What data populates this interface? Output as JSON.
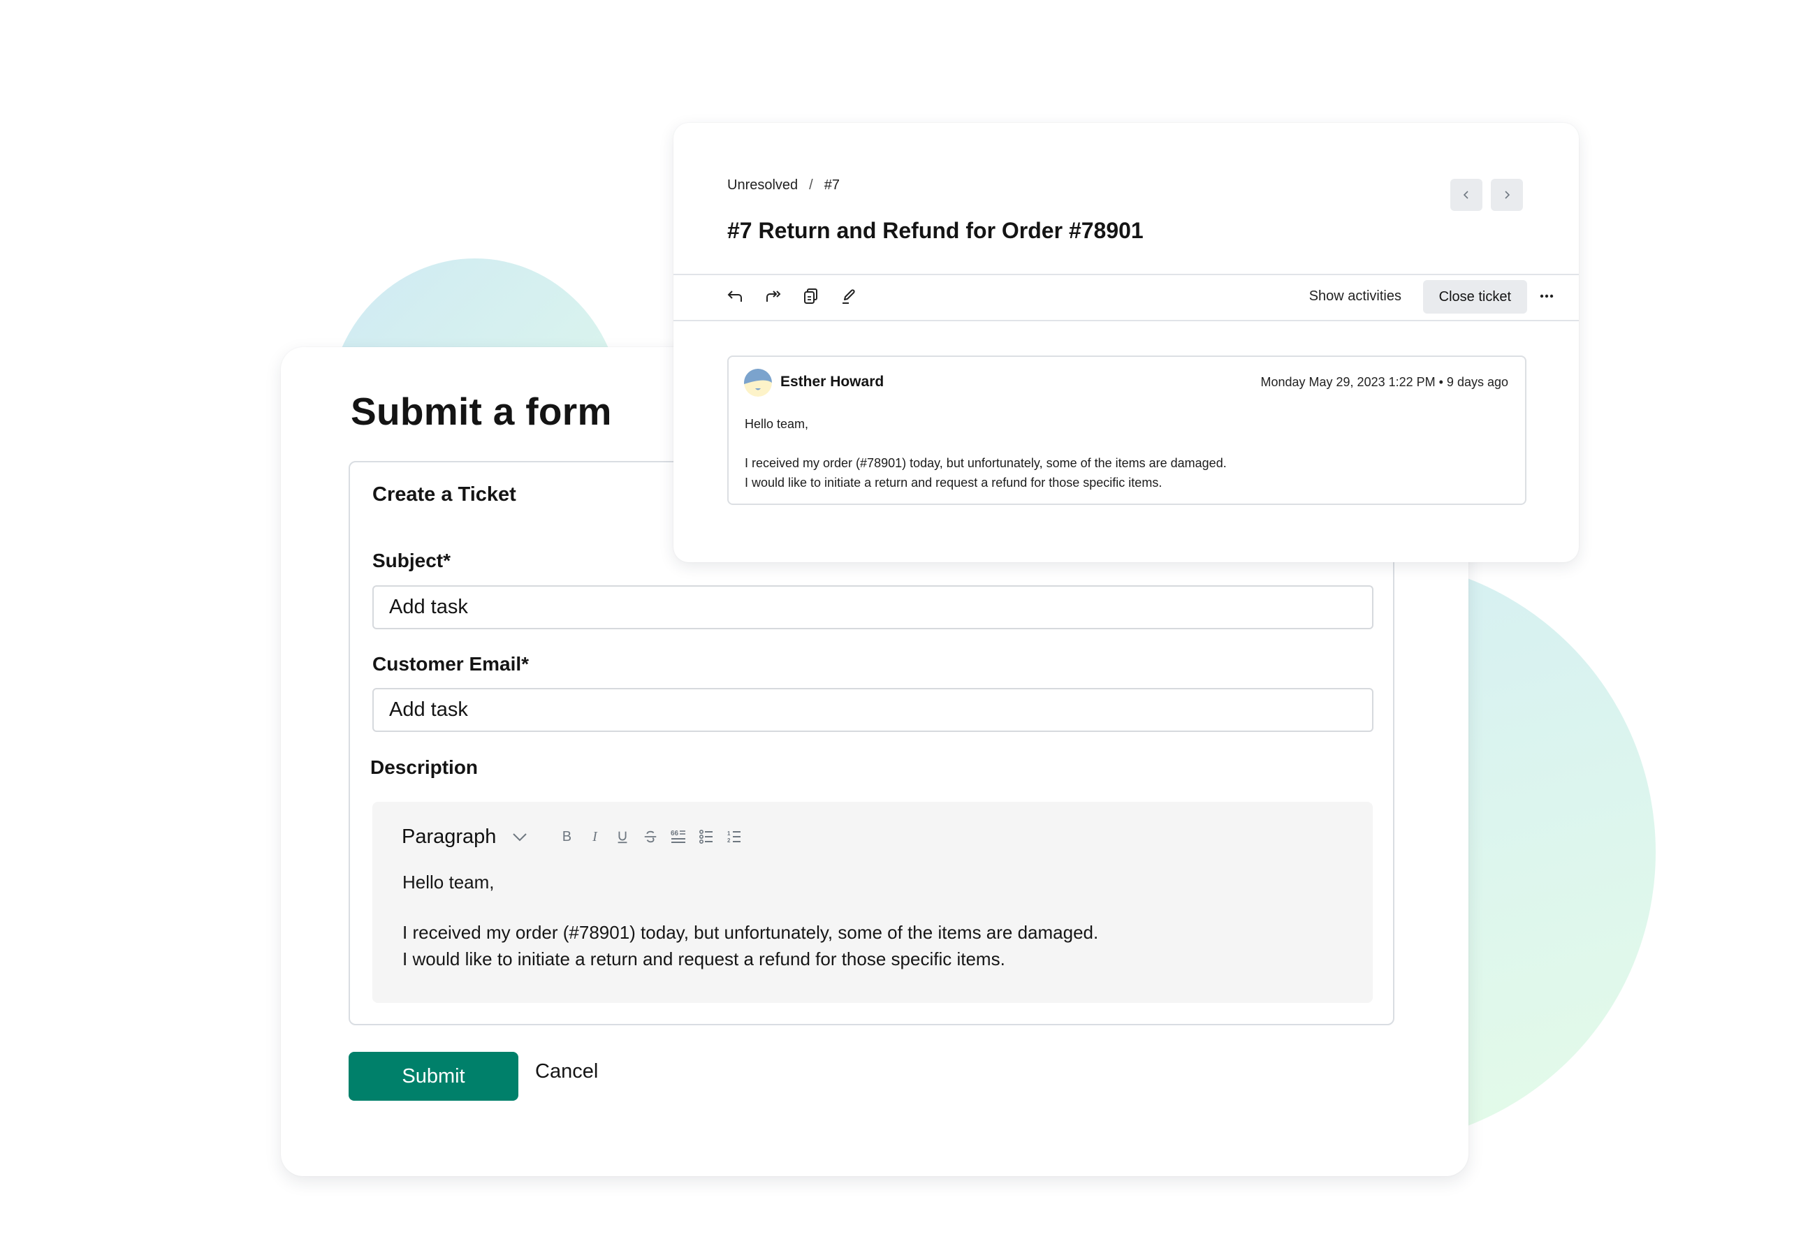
{
  "colors": {
    "accent": "#00806a",
    "neutral_button": "#e9ebee",
    "editor_bg": "#f5f5f5",
    "avatar_hair": "#7ba3cd",
    "avatar_face": "#fdf3c9"
  },
  "form": {
    "title": "Submit a form",
    "section_title": "Create a Ticket",
    "fields": [
      {
        "label": "Subject*",
        "value": "Add task"
      },
      {
        "label": "Customer Email*",
        "value": "Add task"
      }
    ],
    "description": {
      "label": "Description",
      "block_type": "Paragraph",
      "toolbar": [
        {
          "icon": "bold-icon",
          "glyph": "B"
        },
        {
          "icon": "italic-icon",
          "glyph": "I"
        },
        {
          "icon": "underline-icon",
          "glyph": "U"
        },
        {
          "icon": "strikethrough-icon",
          "glyph": "S"
        },
        {
          "icon": "blockquote-icon",
          "glyph": "quote"
        },
        {
          "icon": "bullet-list-icon",
          "glyph": "list"
        },
        {
          "icon": "numbered-list-icon",
          "glyph": "ordered-list"
        }
      ],
      "lines": [
        "Hello team,",
        "I received my order (#78901) today, but unfortunately, some of the items are damaged.",
        "I would like to initiate a return and request a refund for those specific items."
      ]
    },
    "submit_label": "Submit",
    "cancel_label": "Cancel"
  },
  "ticket": {
    "breadcrumb": [
      "Unresolved",
      "#7"
    ],
    "breadcrumb_separator": "/",
    "title": "#7 Return and Refund for Order #78901",
    "toolbar_icons": [
      "reply-icon",
      "forward-icon",
      "copy-icon",
      "edit-icon"
    ],
    "show_activities_label": "Show activities",
    "close_ticket_label": "Close ticket",
    "more_icon": "more-horizontal-icon",
    "message": {
      "author": "Esther Howard",
      "timestamp": "Monday May 29, 2023 1:22 PM",
      "relative_time": "9 days ago",
      "time_display": "Monday May 29, 2023 1:22 PM • 9 days ago",
      "lines": [
        "Hello team,",
        "I received my order (#78901) today, but unfortunately, some of the items are damaged.",
        "I would like to initiate a return and request a refund for those specific items."
      ]
    }
  }
}
